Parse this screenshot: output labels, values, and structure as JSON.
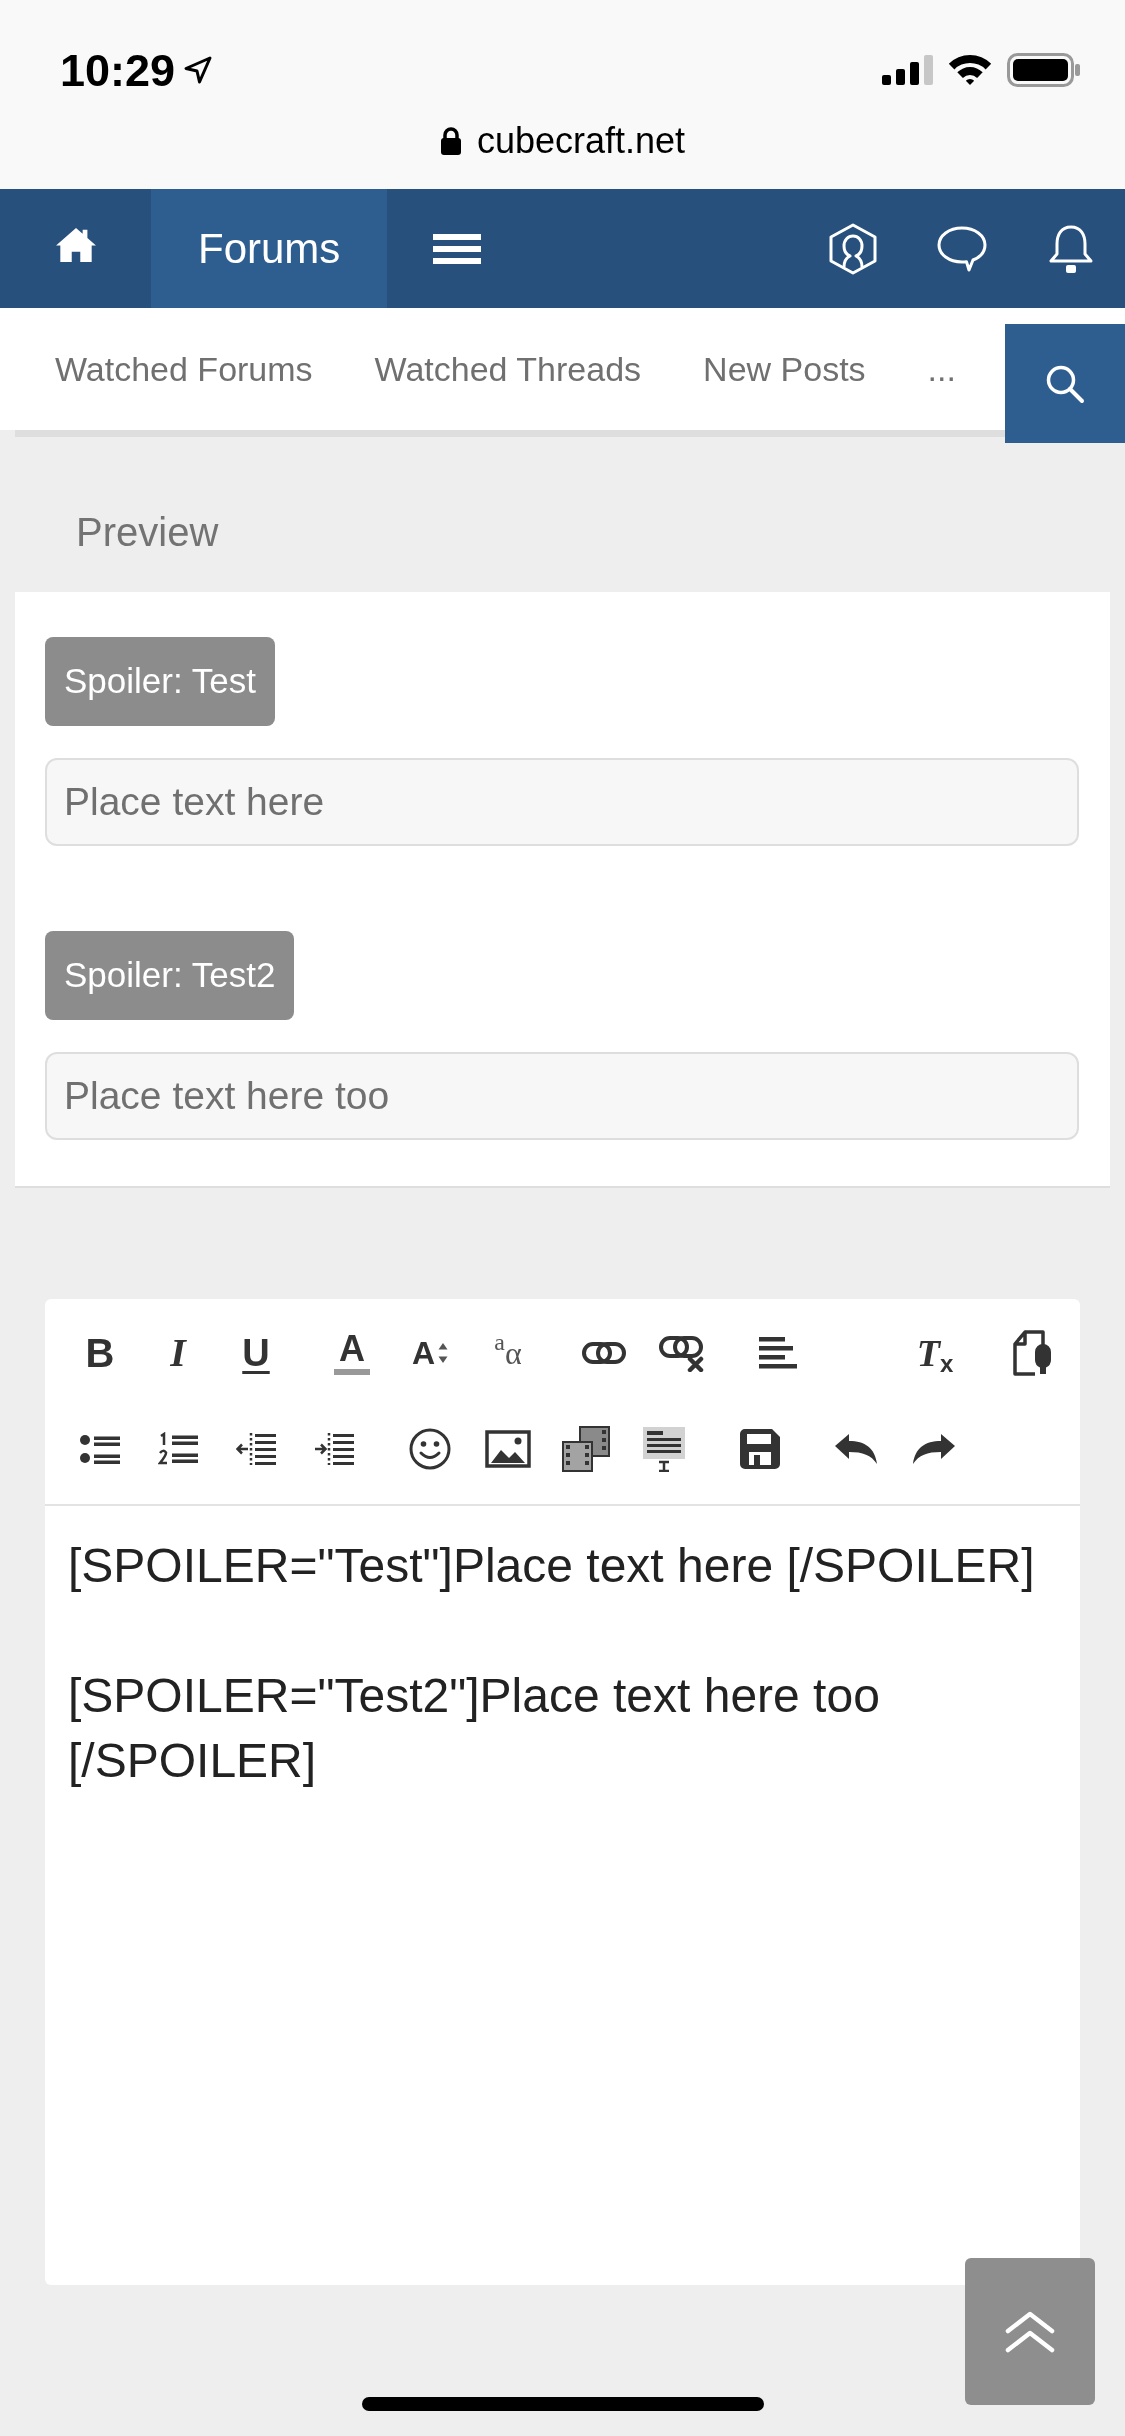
{
  "status_bar": {
    "time": "10:29"
  },
  "browser": {
    "url": "cubecraft.net"
  },
  "nav": {
    "tabs": [
      {
        "label": "Forums",
        "selected": true
      }
    ]
  },
  "sub_nav": {
    "links": [
      "Watched Forums",
      "Watched Threads",
      "New Posts",
      "..."
    ]
  },
  "preview": {
    "title": "Preview",
    "spoilers": [
      {
        "button": "Spoiler: Test",
        "content": "Place text here"
      },
      {
        "button": "Spoiler: Test2",
        "content": "Place text here too"
      }
    ]
  },
  "editor": {
    "toolbar": [
      {
        "groups": [
          {
            "tools": [
              {
                "kind": "bold",
                "label": "B"
              },
              {
                "kind": "italic",
                "label": "I"
              },
              {
                "kind": "underline",
                "label": "U"
              }
            ]
          },
          {
            "tools": [
              {
                "kind": "color",
                "label": "A"
              },
              {
                "kind": "size",
                "label": "A"
              },
              {
                "kind": "symbol",
                "label": "$^{a}$α"
              }
            ]
          },
          {
            "tools": [
              {
                "kind": "link"
              },
              {
                "kind": "unlink"
              }
            ]
          },
          {
            "tools": [
              {
                "kind": "align"
              }
            ]
          },
          {
            "tools": [
              {
                "kind": "clear",
                "label": "T$_{x}$"
              }
            ]
          },
          {
            "tools": [
              {
                "kind": "source"
              }
            ]
          }
        ]
      },
      {
        "groups": [
          {
            "tools": [
              {
                "kind": "bullets"
              },
              {
                "kind": "numbers"
              },
              {
                "kind": "outdent"
              },
              {
                "kind": "indent"
              }
            ]
          },
          {
            "tools": [
              {
                "kind": "smilie"
              },
              {
                "kind": "image"
              },
              {
                "kind": "media"
              },
              {
                "kind": "template"
              }
            ]
          },
          {
            "tools": [
              {
                "kind": "save"
              }
            ]
          },
          {
            "tools": [
              {
                "kind": "undo"
              },
              {
                "kind": "redo"
              }
            ]
          }
        ]
      }
    ],
    "paragraphs": [
      "[SPOILER=\"Test\"]Place text here [/SPOILER]",
      "[SPOILER=\"Test2\"]Place text here too [/SPOILER]"
    ]
  }
}
